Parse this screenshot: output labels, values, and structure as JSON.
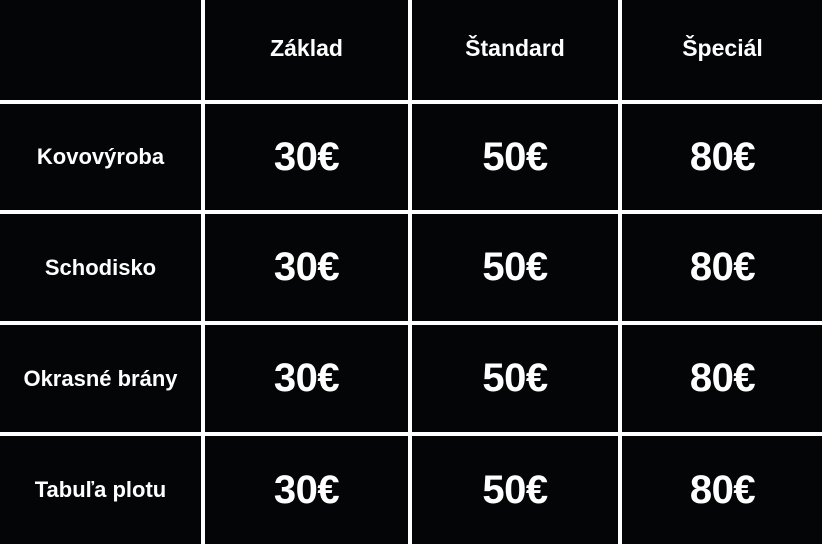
{
  "table": {
    "corner": "",
    "columns": [
      "Základ",
      "Štandard",
      "Špeciál"
    ],
    "rows": [
      {
        "label": "Kovovýroba",
        "prices": [
          "30€",
          "50€",
          "80€"
        ]
      },
      {
        "label": "Schodisko",
        "prices": [
          "30€",
          "50€",
          "80€"
        ]
      },
      {
        "label": "Okrasné brány",
        "prices": [
          "30€",
          "50€",
          "80€"
        ]
      },
      {
        "label": "Tabuľa plotu",
        "prices": [
          "30€",
          "50€",
          "80€"
        ]
      }
    ]
  },
  "colors": {
    "cell_background": "#040506",
    "grid_lines": "#ffffff",
    "text": "#ffffff"
  }
}
